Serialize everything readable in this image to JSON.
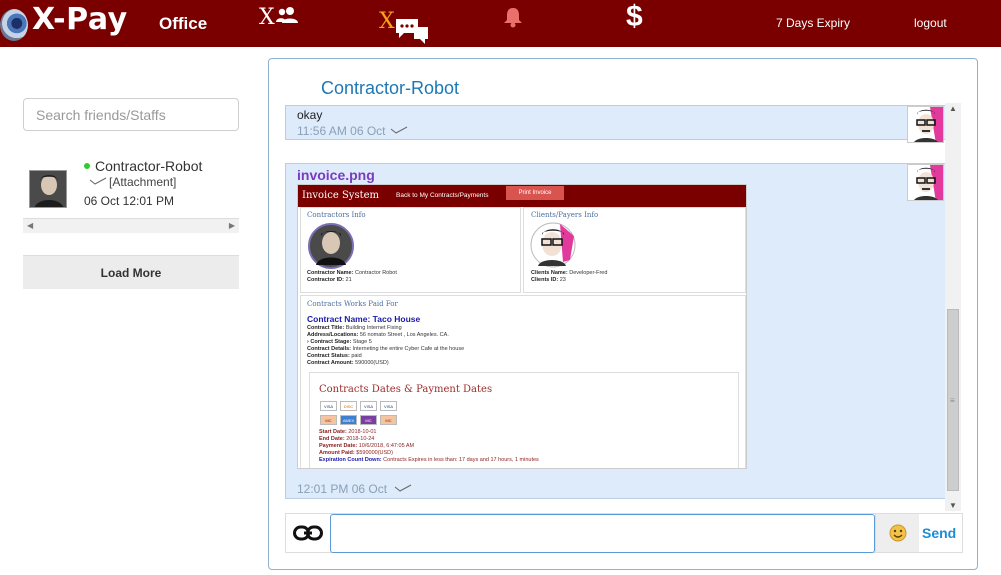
{
  "header": {
    "brand": "X-Pay",
    "office_label": "Office",
    "friends_x": "X",
    "chat_x": "X",
    "dollar": "$",
    "expiry_label": "7 Days Expiry",
    "logout_label": "logout",
    "bar_color": "#7a0000",
    "accent_color": "#f7a21a"
  },
  "sidebar": {
    "search_placeholder": "Search friends/Staffs",
    "contacts": [
      {
        "name": "Contractor-Robot",
        "preview": "[Attachment]",
        "time": "06 Oct 12:01 PM",
        "status": "online"
      }
    ],
    "load_more_label": "Load More"
  },
  "chat": {
    "title": "Contractor-Robot",
    "messages": [
      {
        "type": "text",
        "text": "okay",
        "time": "11:56 AM 06 Oct"
      },
      {
        "type": "attachment",
        "filename": "invoice.png",
        "time": "12:01 PM 06 Oct"
      }
    ],
    "invoice": {
      "title": "Invoice System",
      "back_label": "Back to My Contracts/Payments",
      "print_label": "Print Invoice",
      "contractor_section": "Contractors Info",
      "client_section": "Clients/Payers Info",
      "contractor_name_label": "Contractor Name:",
      "contractor_name": "Contractor Robot",
      "contractor_id_label": "Contractor ID:",
      "contractor_id": "21",
      "client_name_label": "Clients Name:",
      "client_name": "Developer-Fred",
      "client_id_label": "Clients ID:",
      "client_id": "23",
      "works_section": "Contracts Works Paid For",
      "contract_name_label": "Contract Name:",
      "contract_name": "Taco House",
      "title_label": "Contract Title:",
      "title_value": "Building Internet Fixing",
      "address_label": "Address/Locations:",
      "address_value": "56 nomato Street , Los Angeles. CA.",
      "stage_label": "› Contract Stage:",
      "stage_value": "Stage 5",
      "details_label": "Contract Details:",
      "details_value": "Interneting the entire Cyber Cafe at the house",
      "status_label": "Contract Status:",
      "status_value": "paid",
      "amount_label": "Contract Amount:",
      "amount_value": "590000(USD)",
      "dates_section": "Contracts Dates & Payment Dates",
      "start_label": "Start Date:",
      "start_value": "2018-10-01",
      "end_label": "End Date:",
      "end_value": "2018-10-24",
      "paydate_label": "Payment Date:",
      "paydate_value": "10/6/2018, 6:47:05 AM",
      "paid_label": "Amount Paid:",
      "paid_value": "$590000(USD)",
      "countdown_label": "Expiration Count Down:",
      "countdown_value": "Contracts Expires in less than: 17 days and 17 hours, 1 minutes",
      "cards": [
        "VISA",
        "DISC",
        "VISA",
        "VISA",
        "MC",
        "AMEX",
        "MC",
        "MC"
      ]
    }
  },
  "composer": {
    "input_value": "",
    "input_placeholder": "",
    "send_label": "Send"
  }
}
